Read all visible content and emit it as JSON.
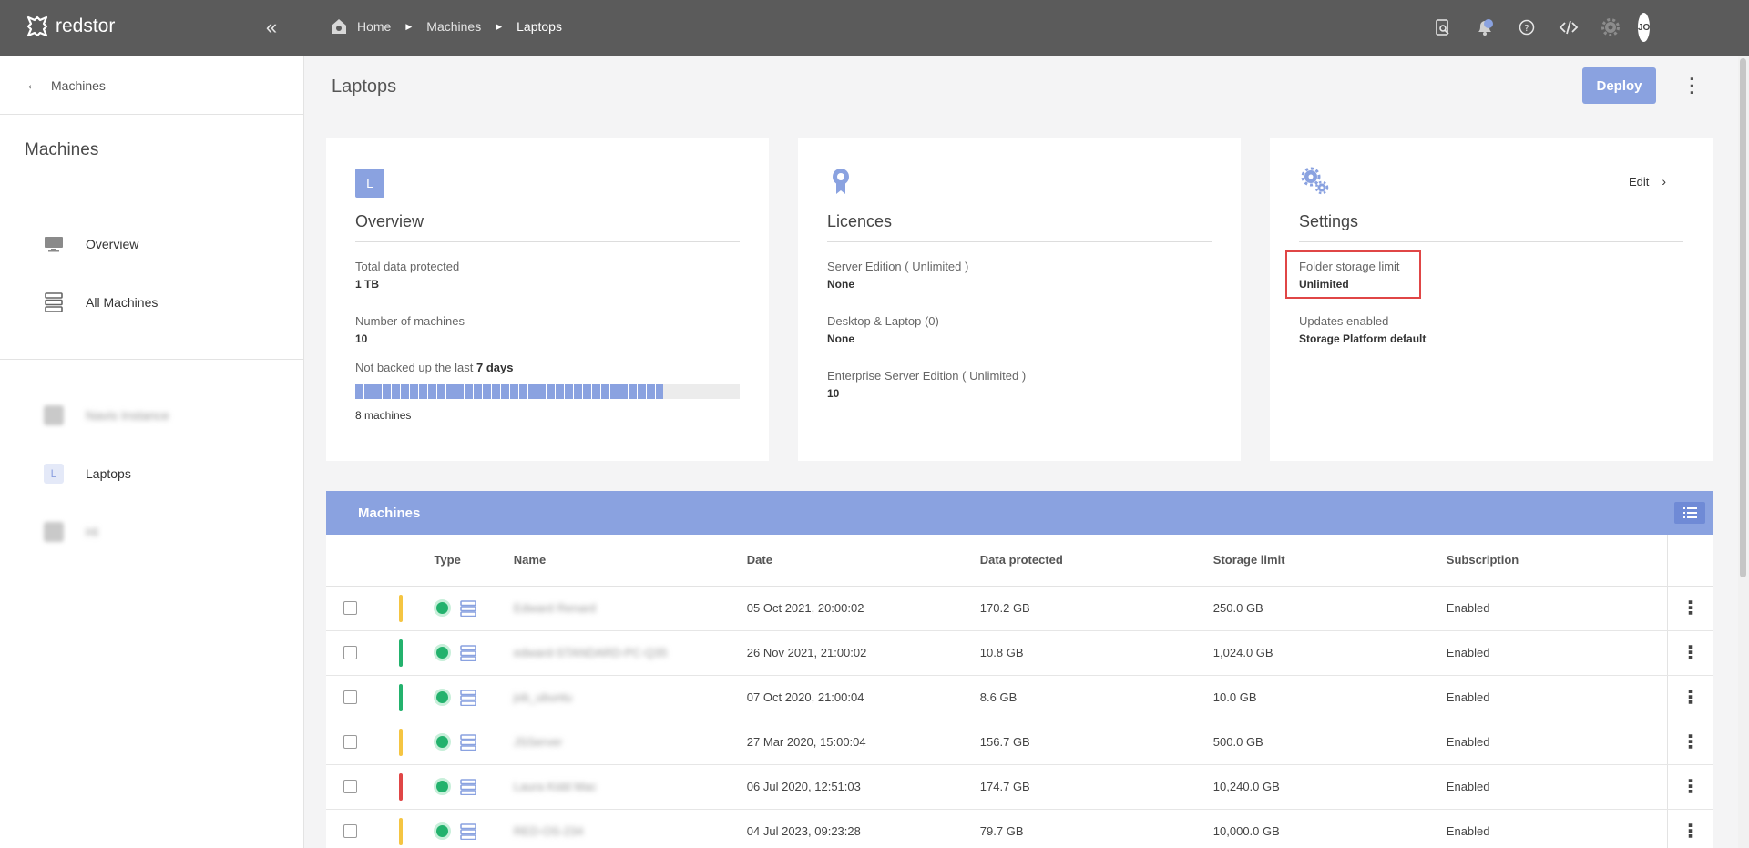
{
  "topbar": {
    "logo_text": "redstor",
    "breadcrumb": [
      "Home",
      "Machines",
      "Laptops"
    ],
    "icons": [
      "search-machine-icon",
      "notifications-icon",
      "help-icon",
      "api-icon",
      "settings-icon"
    ],
    "avatar_initials": "JO"
  },
  "sidebar": {
    "back_label": "Machines",
    "title": "Machines",
    "nav": [
      {
        "label": "Overview",
        "icon": "monitor-icon"
      },
      {
        "label": "All Machines",
        "icon": "server-stack-icon"
      }
    ],
    "groups": [
      {
        "label": "Navis Instance",
        "blurred": true
      },
      {
        "label": "Laptops",
        "badge": "L",
        "blurred": false
      },
      {
        "label": "HI",
        "blurred": true
      }
    ]
  },
  "page": {
    "title": "Laptops",
    "deploy_label": "Deploy"
  },
  "overview": {
    "badge": "L",
    "title": "Overview",
    "total_label": "Total data protected",
    "total_value": "1 TB",
    "machines_label": "Number of machines",
    "machines_value": "10",
    "not_backed_prefix": "Not backed up the last",
    "not_backed_days": "7 days",
    "not_backed_value": "8 machines",
    "not_backed_fraction": 0.8
  },
  "licences": {
    "title": "Licences",
    "items": [
      {
        "label": "Server Edition ( Unlimited )",
        "value": "None"
      },
      {
        "label": "Desktop & Laptop (0)",
        "value": "None"
      },
      {
        "label": "Enterprise Server Edition ( Unlimited )",
        "value": "10"
      }
    ]
  },
  "settings": {
    "title": "Settings",
    "edit_label": "Edit",
    "items": [
      {
        "label": "Folder storage limit",
        "value": "Unlimited"
      },
      {
        "label": "Updates enabled",
        "value": "Storage Platform default"
      }
    ]
  },
  "machines_table": {
    "title": "Machines",
    "columns": [
      "Type",
      "Name",
      "Date",
      "Data protected",
      "Storage limit",
      "Subscription"
    ],
    "rows": [
      {
        "status_color": "#f5c542",
        "name": "Edward Renard",
        "date": "05 Oct 2021, 20:00:02",
        "data": "170.2 GB",
        "limit": "250.0 GB",
        "sub": "Enabled"
      },
      {
        "status_color": "#23b26d",
        "name": "edward-STANDARD-PC-Q35",
        "date": "26 Nov 2021, 21:00:02",
        "data": "10.8 GB",
        "limit": "1,024.0 GB",
        "sub": "Enabled"
      },
      {
        "status_color": "#23b26d",
        "name": "job_ubuntu",
        "date": "07 Oct 2020, 21:00:04",
        "data": "8.6 GB",
        "limit": "10.0 GB",
        "sub": "Enabled"
      },
      {
        "status_color": "#f5c542",
        "name": "JSServer",
        "date": "27 Mar 2020, 15:00:04",
        "data": "156.7 GB",
        "limit": "500.0 GB",
        "sub": "Enabled"
      },
      {
        "status_color": "#e04646",
        "name": "Laura Kidd Mac",
        "date": "06 Jul 2020, 12:51:03",
        "data": "174.7 GB",
        "limit": "10,240.0 GB",
        "sub": "Enabled"
      },
      {
        "status_color": "#f5c542",
        "name": "RED-OS-234",
        "date": "04 Jul 2023, 09:23:28",
        "data": "79.7 GB",
        "limit": "10,000.0 GB",
        "sub": "Enabled"
      }
    ]
  }
}
